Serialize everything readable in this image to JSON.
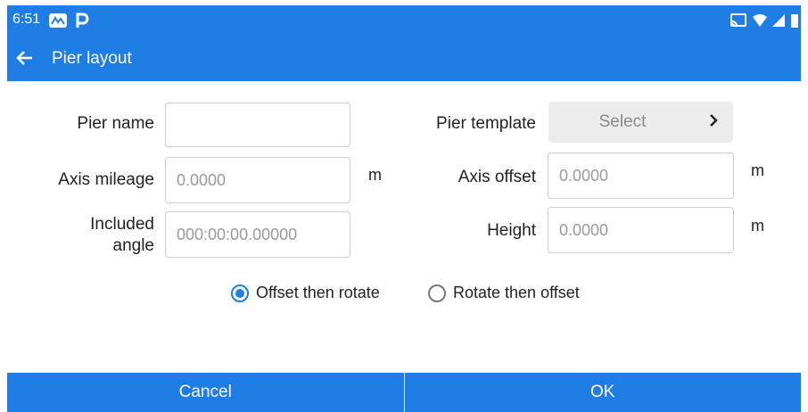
{
  "statusbar": {
    "time": "6:51"
  },
  "appbar": {
    "title": "Pier layout"
  },
  "form": {
    "pier_name": {
      "label": "Pier name",
      "value": ""
    },
    "pier_template": {
      "label": "Pier template",
      "value": "Select"
    },
    "axis_mileage": {
      "label": "Axis mileage",
      "placeholder": "0.0000",
      "unit": "m"
    },
    "axis_offset": {
      "label": "Axis offset",
      "placeholder": "0.0000",
      "unit": "m"
    },
    "included_angle": {
      "label_line1": "Included",
      "label_line2": "angle",
      "placeholder": "000:00:00.00000"
    },
    "height": {
      "label": "Height",
      "placeholder": "0.0000",
      "unit": "m"
    }
  },
  "mode": {
    "options": [
      "Offset then rotate",
      "Rotate then offset"
    ],
    "selected": "Offset then rotate"
  },
  "buttons": {
    "cancel": "Cancel",
    "ok": "OK"
  },
  "colors": {
    "accent": "#1f7de6"
  }
}
